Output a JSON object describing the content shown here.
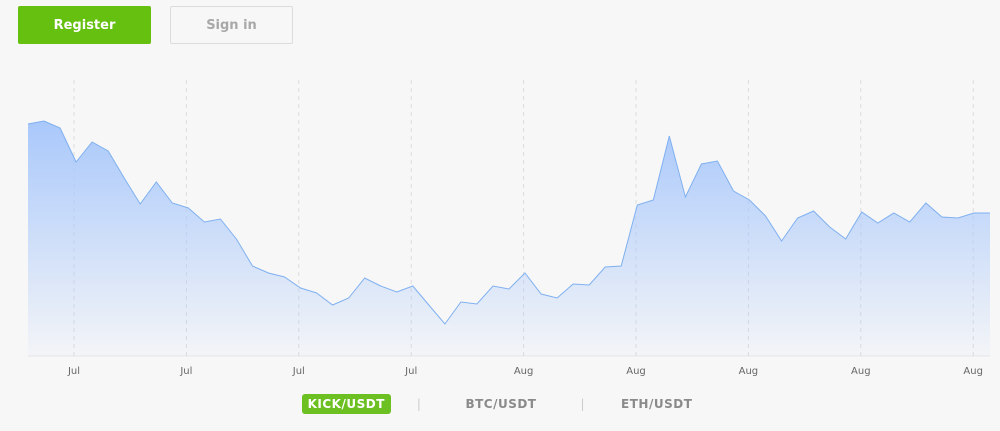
{
  "header": {
    "register_label": "Register",
    "signin_label": "Sign in"
  },
  "pairs": [
    {
      "label": "KICK/USDT",
      "active": true
    },
    {
      "label": "BTC/USDT",
      "active": false
    },
    {
      "label": "ETH/USDT",
      "active": false
    }
  ],
  "colors": {
    "accent": "#65c00f",
    "line": "#7fb0f0",
    "fill_top": "#a9c8fb"
  },
  "chart_data": {
    "type": "area",
    "title": "",
    "xlabel": "",
    "ylabel": "",
    "x_ticks": [
      "Jul",
      "Jul",
      "Jul",
      "Jul",
      "Aug",
      "Aug",
      "Aug",
      "Aug",
      "Aug"
    ],
    "grid": "vertical-dashed",
    "ylim": [
      0,
      280
    ],
    "values": [
      232,
      235,
      228,
      194,
      214,
      205,
      178,
      152,
      174,
      153,
      148,
      134,
      137,
      117,
      90,
      83,
      79,
      68,
      63,
      51,
      58,
      78,
      70,
      64,
      70,
      51,
      32,
      54,
      52,
      70,
      67,
      83,
      62,
      58,
      72,
      71,
      89,
      90,
      151,
      156,
      220,
      159,
      192,
      195,
      165,
      156,
      140,
      115,
      138,
      145,
      129,
      117,
      144,
      133,
      143,
      134,
      153,
      139,
      138,
      143,
      143
    ]
  }
}
